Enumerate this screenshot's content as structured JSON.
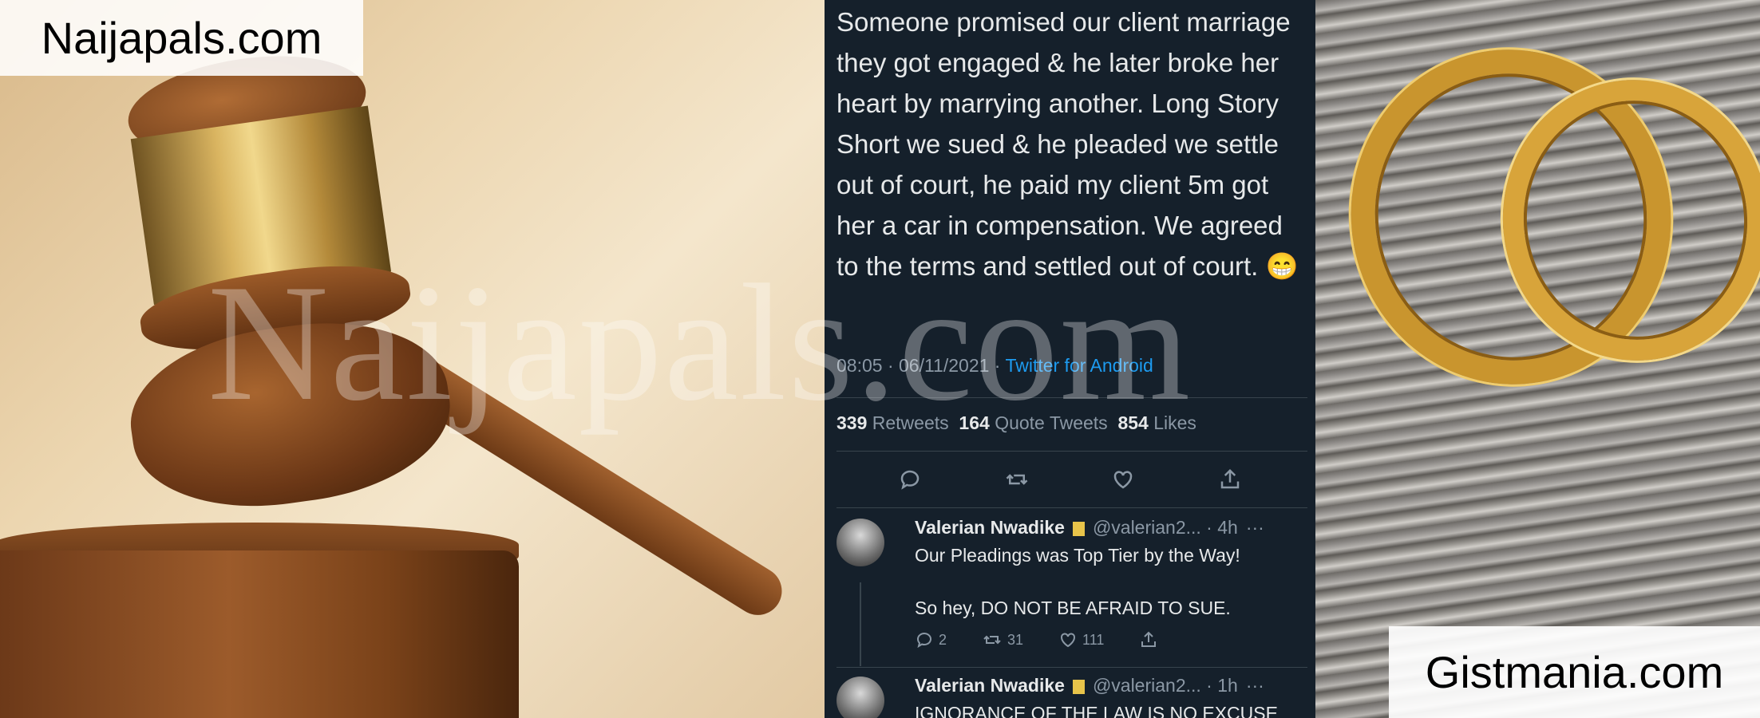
{
  "left_panel": {
    "site_label": "Naijapals.com"
  },
  "watermark": "Naijapals.com",
  "tweet": {
    "text": "Someone promised our client marriage they got engaged & he later broke her heart by marrying another. Long Story Short we sued & he pleaded we settle out of court, he paid my client 5m got her a car in compensation. We agreed to the terms and settled out of court. 😁",
    "time": "08:05 · 06/11/2021 · ",
    "source": "Twitter for Android",
    "retweets": "339",
    "retweets_label": "Retweets",
    "quotes": "164",
    "quotes_label": "Quote Tweets",
    "likes": "854",
    "likes_label": "Likes"
  },
  "replies": [
    {
      "name": "Valerian Nwadike",
      "handle": "@valerian2... · 4h",
      "more": "···",
      "line1": "Our Pleadings was Top Tier by the Way!",
      "line2": "So hey, DO NOT BE AFRAID TO SUE.",
      "reply_count": "2",
      "retweet_count": "31",
      "like_count": "111"
    },
    {
      "name": "Valerian Nwadike",
      "handle": "@valerian2... · 1h",
      "more": "···",
      "line1": "IGNORANCE OF THE LAW IS NO EXCUSE"
    }
  ],
  "right_panel": {
    "site_label": "Gistmania.com"
  },
  "colors": {
    "tweet_bg": "#15202b",
    "link_blue": "#1d9bf0",
    "muted": "#8b98a5"
  },
  "icons": [
    "reply-icon",
    "retweet-icon",
    "like-icon",
    "share-icon",
    "verified-badge-icon"
  ]
}
